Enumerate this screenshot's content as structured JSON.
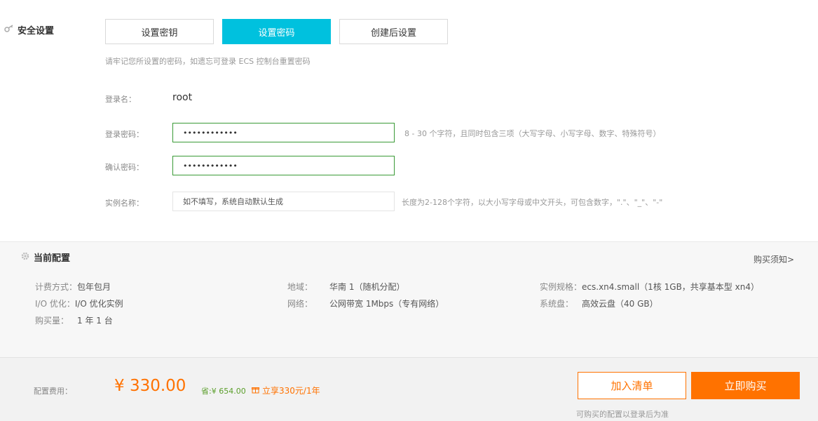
{
  "security": {
    "title": "安全设置",
    "tabs": [
      {
        "label": "设置密钥",
        "active": false
      },
      {
        "label": "设置密码",
        "active": true
      },
      {
        "label": "创建后设置",
        "active": false
      }
    ],
    "hint": "请牢记您所设置的密码，如遗忘可登录 ECS 控制台重置密码",
    "login_name_label": "登录名：",
    "login_name_value": "root",
    "password_label": "登录密码：",
    "password_value": "••••••••••••",
    "password_hint": "8 - 30 个字符，且同时包含三项（大写字母、小写字母、数字、特殊符号）",
    "confirm_label": "确认密码：",
    "confirm_value": "••••••••••••",
    "instance_name_label": "实例名称：",
    "instance_name_placeholder": "如不填写，系统自动默认生成",
    "instance_name_hint": "长度为2-128个字符，以大小写字母或中文开头，可包含数字，\".\"、\"_\"、\"-\""
  },
  "config": {
    "title": "当前配置",
    "notice_link": "购买须知>",
    "items": {
      "billing": {
        "key": "计费方式：",
        "value": "包年包月"
      },
      "io": {
        "key": "I/O 优化：",
        "value": "I/O 优化实例"
      },
      "quantity": {
        "key": "购买量：",
        "value": "1 年 1 台"
      },
      "region": {
        "key": "地域：",
        "value": "华南 1（随机分配）"
      },
      "network": {
        "key": "网络：",
        "value": "公网带宽 1Mbps（专有网络）"
      },
      "spec": {
        "key": "实例规格：",
        "value": "ecs.xn4.small（1核 1GB，共享基本型 xn4）"
      },
      "disk": {
        "key": "系统盘：",
        "value": "高效云盘（40 GB）"
      }
    }
  },
  "footer": {
    "price_label": "配置费用：",
    "price": "¥ 330.00",
    "save": "省:¥ 654.00",
    "offer": "立享330元/1年",
    "cart_button": "加入清单",
    "buy_button": "立即购买",
    "note": "可购买的配置以登录后为准"
  },
  "colors": {
    "accent": "#00c1de",
    "orange": "#ff7200",
    "input_border": "#3a9a36"
  },
  "icons": {
    "security": "key-icon",
    "config": "gear-icon",
    "offer": "gift-icon"
  }
}
